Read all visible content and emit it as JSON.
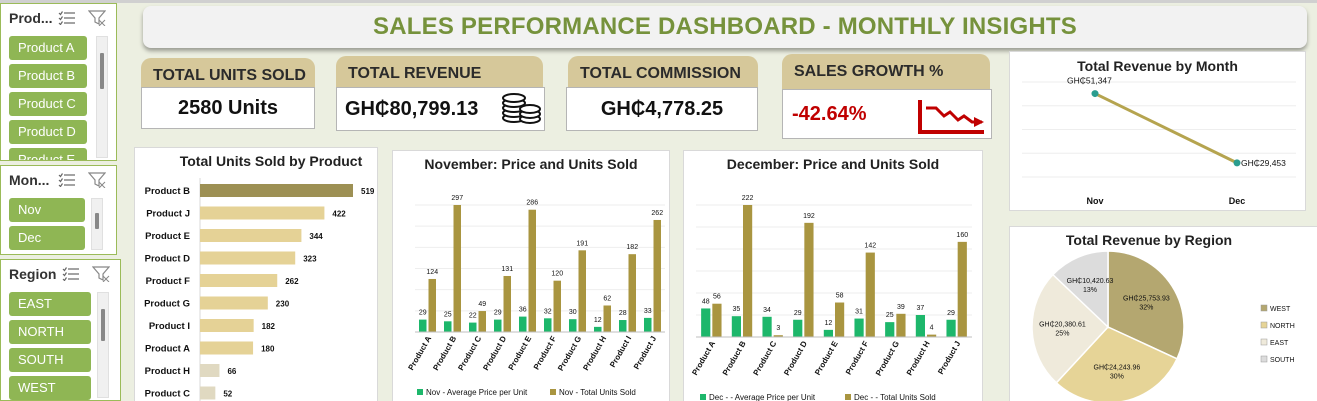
{
  "title": "SALES PERFORMANCE DASHBOARD - MONTHLY INSIGHTS",
  "slicers": {
    "product": {
      "title": "Prod...",
      "items": [
        "Product A",
        "Product B",
        "Product C",
        "Product D",
        "Product E"
      ]
    },
    "month": {
      "title": "Mon...",
      "items": [
        "Nov",
        "Dec"
      ]
    },
    "region": {
      "title": "Region",
      "items": [
        "EAST",
        "NORTH",
        "SOUTH",
        "WEST"
      ]
    }
  },
  "kpis": {
    "units": {
      "label": "TOTAL UNITS SOLD",
      "value": "2580 Units"
    },
    "revenue": {
      "label": "TOTAL REVENUE",
      "value": "GH₵80,799.13"
    },
    "commission": {
      "label": "TOTAL COMMISSION",
      "value": "GH₵4,778.25"
    },
    "growth": {
      "label": "SALES GROWTH %",
      "value": "-42.64%"
    }
  },
  "colors": {
    "accent": "#76923c",
    "slicer": "#8fb654",
    "tan": "#d6c89a",
    "gold": "#a99540",
    "green": "#1db76b",
    "negative": "#c00000"
  },
  "chart_data": [
    {
      "id": "units_by_product",
      "type": "bar",
      "title": "Total Units Sold by Product",
      "categories": [
        "Product B",
        "Product J",
        "Product E",
        "Product D",
        "Product F",
        "Product G",
        "Product I",
        "Product A",
        "Product H",
        "Product C"
      ],
      "values": [
        519,
        422,
        344,
        323,
        262,
        230,
        182,
        180,
        66,
        52
      ],
      "xlim": [
        0,
        519
      ]
    },
    {
      "id": "nov_price_units",
      "type": "bar",
      "title": "November: Price and Units Sold",
      "categories": [
        "Product A",
        "Product B",
        "Product C",
        "Product D",
        "Product E",
        "Product F",
        "Product G",
        "Product H",
        "Product I",
        "Product J"
      ],
      "series": [
        {
          "name": "Nov - Average Price per Unit",
          "values": [
            29,
            25,
            22,
            29,
            36,
            32,
            30,
            12,
            28,
            33
          ]
        },
        {
          "name": "Nov - Total Units Sold",
          "values": [
            124,
            297,
            49,
            131,
            286,
            120,
            191,
            62,
            182,
            262
          ]
        }
      ],
      "ylim": [
        0,
        297
      ]
    },
    {
      "id": "dec_price_units",
      "type": "bar",
      "title": "December: Price and Units Sold",
      "categories": [
        "Product A",
        "Product B",
        "Product C",
        "Product D",
        "Product E",
        "Product F",
        "Product G",
        "Product H",
        "Product J"
      ],
      "series": [
        {
          "name": "Dec - - Average Price per Unit",
          "values": [
            48,
            35,
            34,
            29,
            12,
            31,
            25,
            37,
            29
          ]
        },
        {
          "name": "Dec - - Total Units Sold",
          "values": [
            56,
            222,
            3,
            192,
            58,
            142,
            39,
            4,
            160
          ]
        }
      ],
      "ylim": [
        0,
        222
      ]
    },
    {
      "id": "revenue_by_month",
      "type": "line",
      "title": "Total Revenue by Month",
      "categories": [
        "Nov",
        "Dec"
      ],
      "values": [
        51347,
        29453
      ],
      "labels": [
        "GH₵51,347",
        "GH₵29,453"
      ]
    },
    {
      "id": "revenue_by_region",
      "type": "pie",
      "title": "Total Revenue by Region",
      "slices": [
        {
          "name": "WEST",
          "value": 25753.93,
          "label": "GH₵25,753.93",
          "pct": "32%",
          "color": "#b4a770"
        },
        {
          "name": "NORTH",
          "value": 24243.96,
          "label": "GH₵24,243.96",
          "pct": "30%",
          "color": "#e6d497"
        },
        {
          "name": "EAST",
          "value": 20380.61,
          "label": "GH₵20,380.61",
          "pct": "25%",
          "color": "#efeadb"
        },
        {
          "name": "SOUTH",
          "value": 10420.63,
          "label": "GH₵10,420.63",
          "pct": "13%",
          "color": "#dcdcdc"
        }
      ],
      "legend": [
        "WEST",
        "NORTH",
        "EAST",
        "SOUTH"
      ],
      "legend_position": "right"
    }
  ]
}
